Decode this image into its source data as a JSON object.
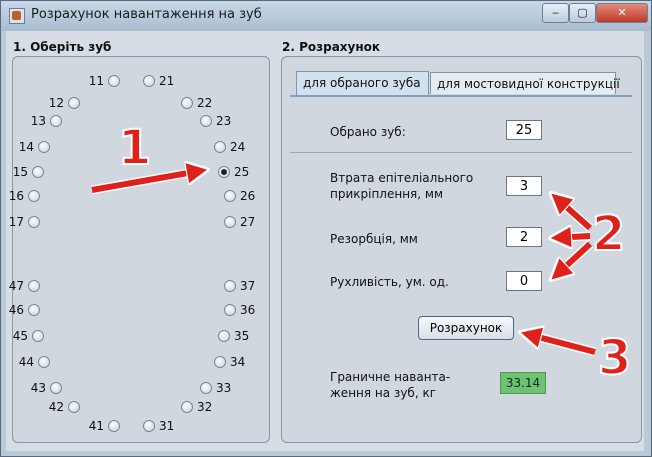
{
  "window": {
    "title": "Розрахунок навантаження на зуб",
    "minimize": "‒",
    "maximize": "▢",
    "close": "✕"
  },
  "left": {
    "title": "1. Оберіть зуб",
    "upper_left": [
      "11",
      "12",
      "13",
      "14",
      "15",
      "16",
      "17"
    ],
    "upper_right": [
      "21",
      "22",
      "23",
      "24",
      "25",
      "26",
      "27"
    ],
    "lower_left": [
      "47",
      "46",
      "45",
      "44",
      "43",
      "42",
      "41"
    ],
    "lower_right": [
      "37",
      "36",
      "35",
      "34",
      "33",
      "32",
      "31"
    ],
    "selected": "25"
  },
  "right": {
    "title": "2. Розрахунок",
    "tabs": [
      "для обраного зуба",
      "для мостовидної конструкції"
    ],
    "selected_tooth_label": "Обрано зуб:",
    "selected_tooth_value": "25",
    "attachment_loss_label_line1": "Втрата епітеліального",
    "attachment_loss_label_line2": "прикріплення, мм",
    "attachment_loss_value": "3",
    "resorption_label": "Резорбція, мм",
    "resorption_value": "2",
    "mobility_label": "Рухливість, ум. од.",
    "mobility_value": "0",
    "calc_button": "Розрахунок",
    "result_label_line1": "Граничне наванта-",
    "result_label_line2": "ження на зуб, кг",
    "result_value": "33.14"
  },
  "annotations": [
    "1",
    "2",
    "3"
  ],
  "colors": {
    "accent_red": "#e0201a",
    "result_green": "#6fc26f"
  }
}
